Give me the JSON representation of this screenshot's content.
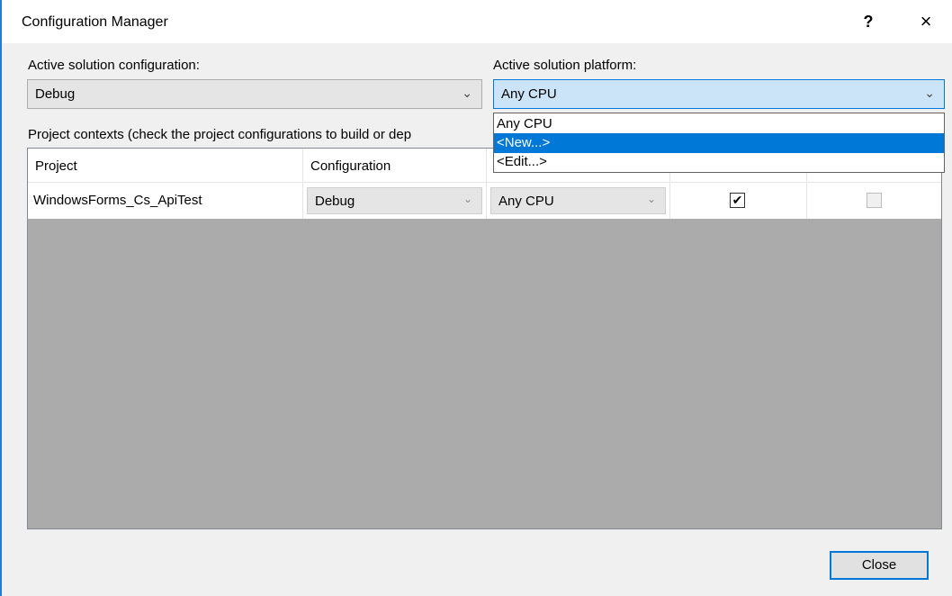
{
  "window": {
    "title": "Configuration Manager",
    "help_glyph": "?",
    "close_glyph": "×"
  },
  "solution": {
    "config_label": "Active solution configuration:",
    "config_value": "Debug",
    "platform_label": "Active solution platform:",
    "platform_value": "Any CPU",
    "platform_options": [
      "Any CPU",
      "<New...>",
      "<Edit...>"
    ],
    "platform_highlighted": "<New...>"
  },
  "contexts": {
    "label": "Project contexts (check the project configurations to build or dep",
    "columns": [
      "Project",
      "Configuration",
      "",
      "",
      ""
    ],
    "rows": [
      {
        "project": "WindowsForms_Cs_ApiTest",
        "configuration": "Debug",
        "platform": "Any CPU",
        "build": true,
        "deploy": false
      }
    ]
  },
  "buttons": {
    "close": "Close"
  },
  "icons": {
    "dropdown": "chevron-down-icon",
    "check": "checkmark-icon"
  },
  "colors": {
    "accent": "#0078d7",
    "focus_fill": "#cce4f7",
    "window_border": "#2b79d0"
  }
}
